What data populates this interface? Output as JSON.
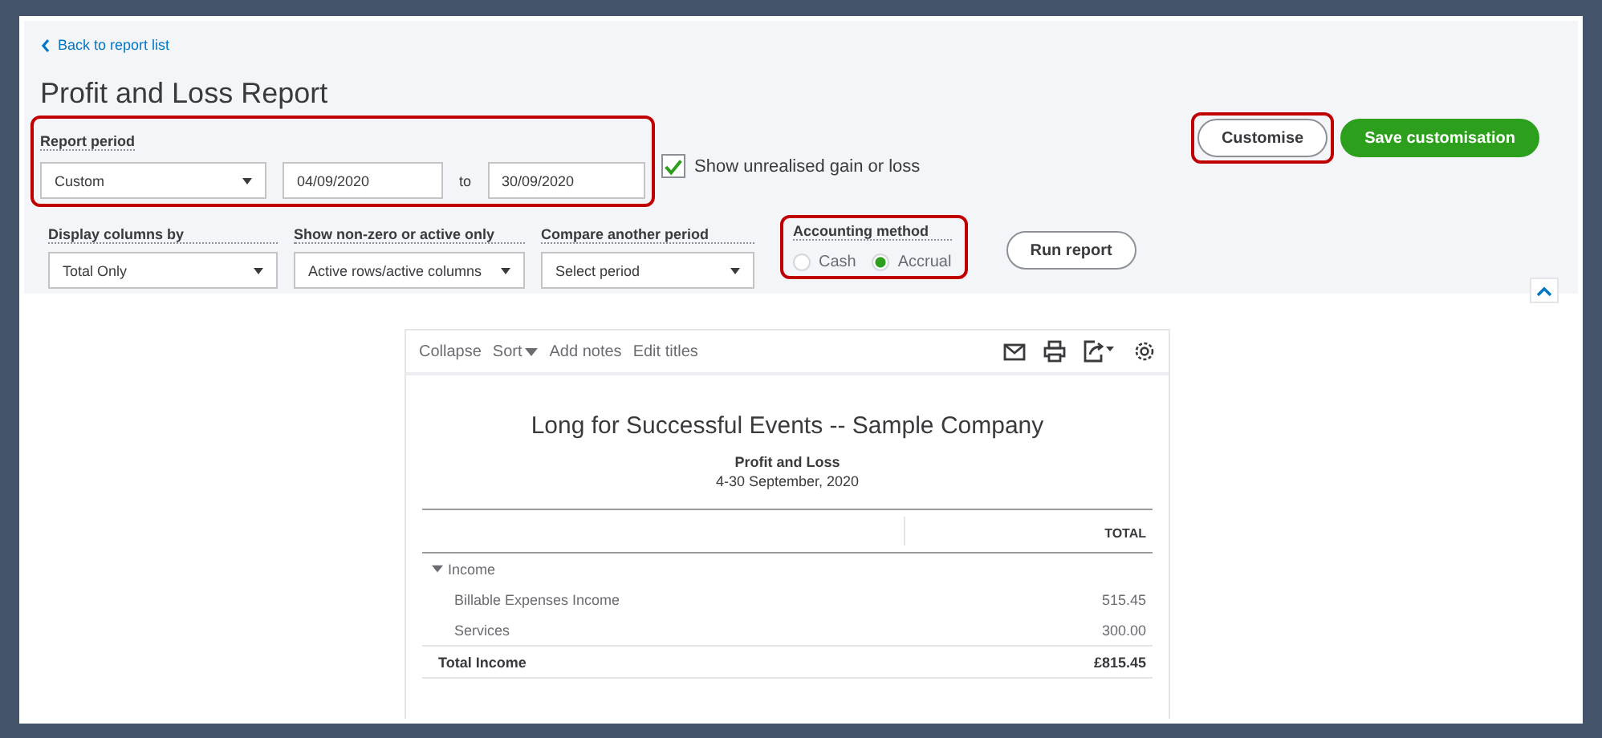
{
  "back_link": "Back to report list",
  "title": "Profit and Loss Report",
  "report_period": {
    "label": "Report period",
    "highlighted": true,
    "period": "Custom",
    "from": "04/09/2020",
    "to_label": "to",
    "to": "30/09/2020"
  },
  "unrealised": {
    "label": "Show unrealised gain or loss",
    "checked": true
  },
  "buttons": [
    {
      "label": "Customise",
      "kind": "outline",
      "highlighted": true
    },
    {
      "label": "Save customisation",
      "kind": "primary",
      "highlighted": false
    }
  ],
  "options": [
    {
      "label": "Display columns by",
      "value": "Total Only"
    },
    {
      "label": "Show non-zero or active only",
      "value": "Active rows/active columns"
    },
    {
      "label": "Compare another period",
      "value": "Select period"
    }
  ],
  "accounting_method": {
    "label": "Accounting method",
    "highlighted": true,
    "choices": [
      {
        "label": "Cash",
        "selected": false
      },
      {
        "label": "Accrual",
        "selected": true
      }
    ]
  },
  "run_report": "Run report",
  "toolbar": {
    "actions": [
      {
        "label": "Collapse",
        "dropdown": false
      },
      {
        "label": "Sort",
        "dropdown": true
      },
      {
        "label": "Add notes",
        "dropdown": false
      },
      {
        "label": "Edit titles",
        "dropdown": false
      }
    ]
  },
  "report": {
    "company": "Long for Successful Events -- Sample Company",
    "title": "Profit and Loss",
    "period": "4-30 September, 2020",
    "column": "TOTAL",
    "rows": [
      {
        "kind": "group",
        "label": "Income",
        "value": ""
      },
      {
        "kind": "item",
        "label": "Billable Expenses Income",
        "value": "515.45"
      },
      {
        "kind": "item",
        "label": "Services",
        "value": "300.00"
      },
      {
        "kind": "total",
        "label": "Total Income",
        "value": "£815.45"
      }
    ]
  }
}
